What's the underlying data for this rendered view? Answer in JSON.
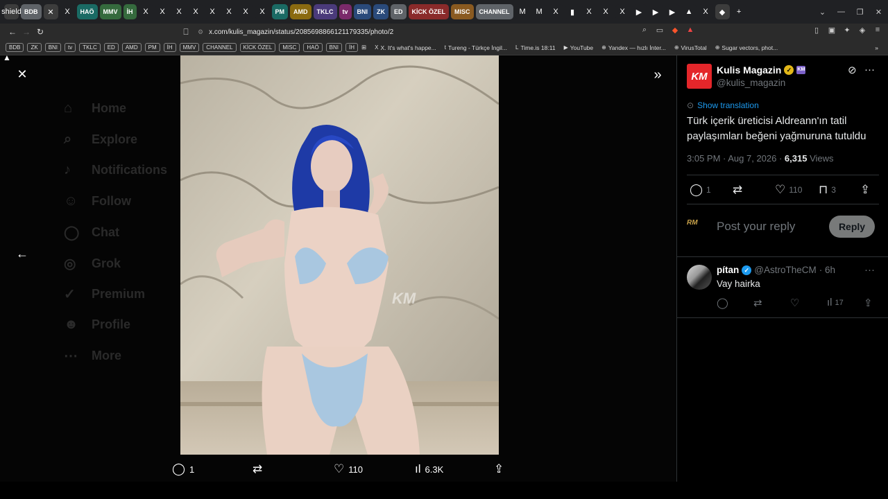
{
  "browser": {
    "tabs": [
      {
        "type": "icon",
        "label": "shield",
        "color": "#3c3c3c"
      },
      {
        "type": "grp",
        "label": "BDB",
        "color": "#5f6368"
      },
      {
        "type": "icon",
        "label": "✕",
        "color": "#3c3c3c"
      },
      {
        "type": "icon",
        "label": "X",
        "color": "#202124"
      },
      {
        "type": "grp",
        "label": "HAÖ",
        "color": "#1a6a64"
      },
      {
        "type": "grp",
        "label": "MMV",
        "color": "#356a3d"
      },
      {
        "type": "grp",
        "label": "İH",
        "color": "#356a3d"
      },
      {
        "type": "icon",
        "label": "X",
        "color": "#202124"
      },
      {
        "type": "icon",
        "label": "X",
        "color": "#202124"
      },
      {
        "type": "icon",
        "label": "X",
        "color": "#202124"
      },
      {
        "type": "icon",
        "label": "X",
        "color": "#202124"
      },
      {
        "type": "icon",
        "label": "X",
        "color": "#202124"
      },
      {
        "type": "icon",
        "label": "X",
        "color": "#202124"
      },
      {
        "type": "icon",
        "label": "X",
        "color": "#202124"
      },
      {
        "type": "icon",
        "label": "X",
        "color": "#202124"
      },
      {
        "type": "grp",
        "label": "PM",
        "color": "#1a6a64"
      },
      {
        "type": "grp",
        "label": "AMD",
        "color": "#8a6a10"
      },
      {
        "type": "grp",
        "label": "TKLC",
        "color": "#4a3a7a"
      },
      {
        "type": "grp",
        "label": "tv",
        "color": "#7a2a6a"
      },
      {
        "type": "grp",
        "label": "BNI",
        "color": "#2a4a7a"
      },
      {
        "type": "grp",
        "label": "ZK",
        "color": "#2a4a7a"
      },
      {
        "type": "grp",
        "label": "ED",
        "color": "#5f6368"
      },
      {
        "type": "grp",
        "label": "KİCK ÖZEL",
        "color": "#8a2a2a"
      },
      {
        "type": "grp",
        "label": "MISC",
        "color": "#8a5a20"
      },
      {
        "type": "grp",
        "label": "CHANNEL",
        "color": "#5f6368"
      },
      {
        "type": "icon",
        "label": "M",
        "color": "#202124"
      },
      {
        "type": "icon",
        "label": "M",
        "color": "#202124"
      },
      {
        "type": "icon",
        "label": "X",
        "color": "#202124"
      },
      {
        "type": "icon",
        "label": "▮",
        "color": "#202124"
      },
      {
        "type": "icon",
        "label": "X",
        "color": "#202124"
      },
      {
        "type": "icon",
        "label": "X",
        "color": "#202124"
      },
      {
        "type": "icon",
        "label": "X",
        "color": "#202124"
      },
      {
        "type": "icon",
        "label": "▶",
        "color": "#202124"
      },
      {
        "type": "icon",
        "label": "▶",
        "color": "#202124"
      },
      {
        "type": "icon",
        "label": "▶",
        "color": "#202124"
      },
      {
        "type": "icon",
        "label": "▲",
        "color": "#202124"
      },
      {
        "type": "icon",
        "label": "X",
        "color": "#202124"
      },
      {
        "type": "icon",
        "label": "◆",
        "color": "#3c3c3c"
      },
      {
        "type": "icon",
        "label": "+",
        "color": "#202124"
      }
    ],
    "url": "x.com/kulis_magazin/status/2085698866121179335/photo/2",
    "bookmark_groups": [
      "BDB",
      "ZK",
      "BNI",
      "tv",
      "TKLC",
      "ED",
      "AMD",
      "PM",
      "İH",
      "MMV",
      "CHANNEL",
      "KİCK ÖZEL",
      "MISC",
      "HAÖ",
      "BNI",
      "İH"
    ],
    "bookmark_links": [
      {
        "icon": "X",
        "label": "X. It's what's happe..."
      },
      {
        "icon": "t",
        "label": "Tureng - Türkçe İngil..."
      },
      {
        "icon": "L",
        "label": "Time.is 18:11"
      },
      {
        "icon": "▶",
        "label": "YouTube"
      },
      {
        "icon": "⊕",
        "label": "Yandex — hızlı İnter..."
      },
      {
        "icon": "⊕",
        "label": "VirusTotal"
      },
      {
        "icon": "⊕",
        "label": "Sugar vectors, phot..."
      }
    ]
  },
  "background_nav": [
    "Home",
    "Explore",
    "Notifications",
    "Follow",
    "Chat",
    "Grok",
    "Premium",
    "Profile",
    "More"
  ],
  "media": {
    "bottom_actions": {
      "replies": "1",
      "reposts": "",
      "likes": "110",
      "views": "6.3K"
    },
    "watermark": "KM"
  },
  "tweet": {
    "avatar_text": "KM",
    "author_name": "Kulis Magazin",
    "author_handle": "@kulis_magazin",
    "affiliate_badge": "KM",
    "show_translation": "Show translation",
    "text": "Türk içerik üreticisi Aldreann'ın tatil paylaşımları beğeni yağmuruna tutuldu",
    "time": "3:05 PM · Aug 7, 2026 · ",
    "views_count": "6,315",
    "views_label": " Views",
    "actions": {
      "replies": "1",
      "reposts": "",
      "likes": "110",
      "bookmarks": "3"
    },
    "reply_avatar_text": "RM",
    "reply_placeholder": "Post your reply",
    "reply_button": "Reply"
  },
  "comment": {
    "name": "pítan",
    "handle": "@AstroTheCM",
    "time": "· 6h",
    "text": "Vay hairka",
    "views": "17"
  }
}
